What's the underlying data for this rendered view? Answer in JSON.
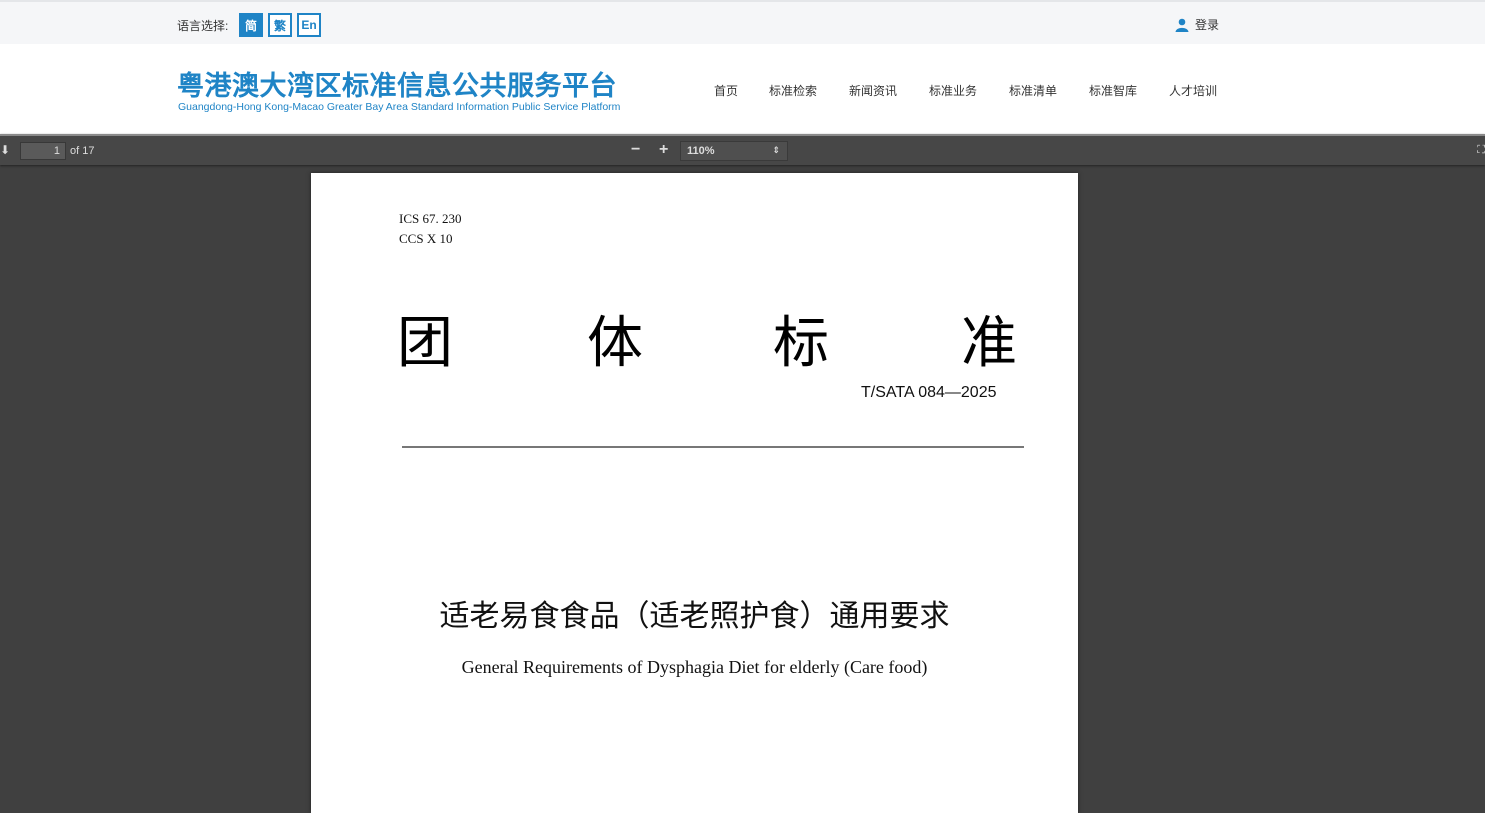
{
  "topbar": {
    "lang_label": "语言选择:",
    "langs": [
      "简",
      "繁",
      "En"
    ],
    "login": "登录"
  },
  "header": {
    "logo_cn": "粤港澳大湾区标准信息公共服务平台",
    "logo_en": "Guangdong-Hong Kong-Macao Greater Bay Area Standard Information Public Service Platform",
    "nav": [
      "首页",
      "标准检索",
      "新闻资讯",
      "标准业务",
      "标准清单",
      "标准智库",
      "人才培训"
    ]
  },
  "viewer": {
    "page": "1",
    "page_of": "of 17",
    "zoom_out": "−",
    "zoom_in": "+",
    "zoom": "110%"
  },
  "document": {
    "ics": "ICS   67. 230",
    "ccs": "CCS  X  10",
    "heading": [
      "团",
      "体",
      "标",
      "准"
    ],
    "code": "T/SATA 084—2025",
    "title_cn": "适老易食食品（适老照护食）通用要求",
    "title_en": "General Requirements of Dysphagia Diet for elderly (Care food)"
  }
}
